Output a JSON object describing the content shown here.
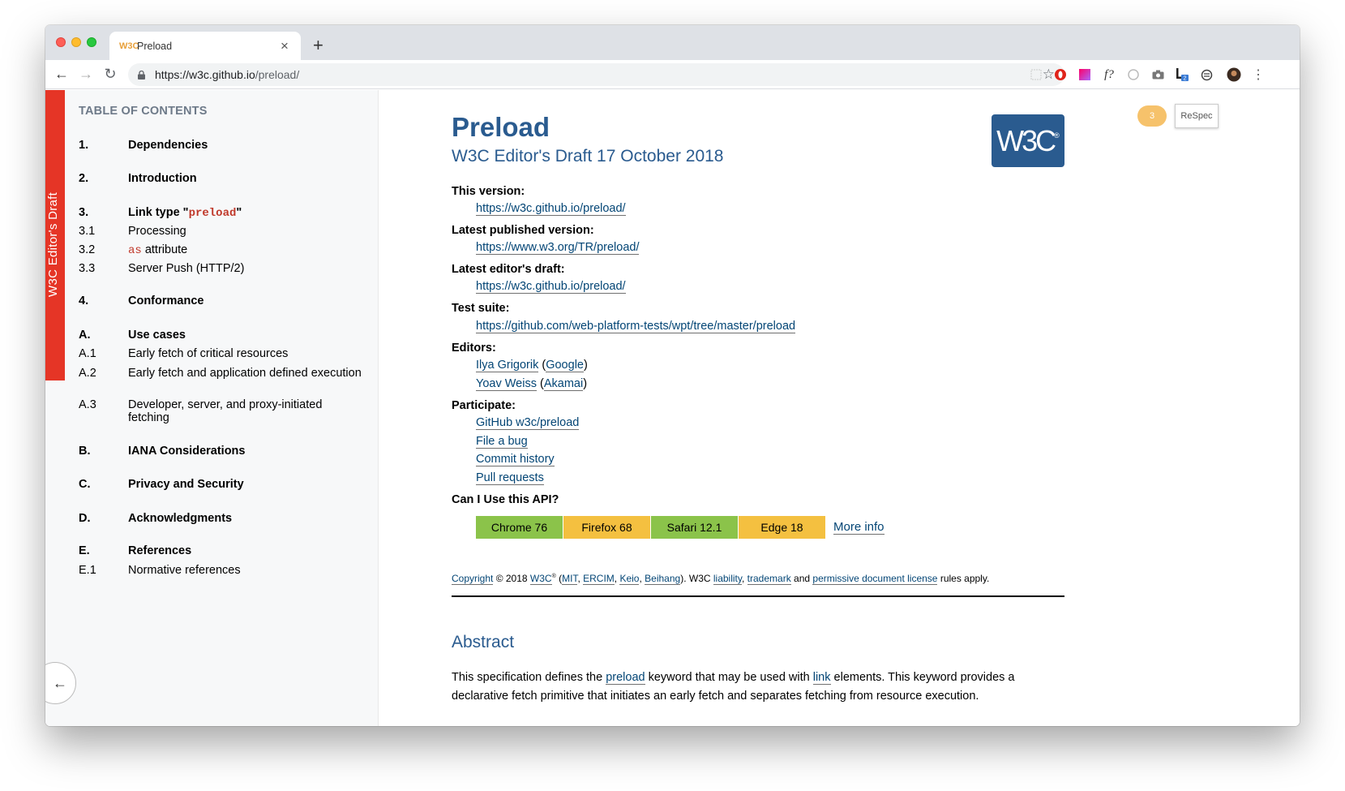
{
  "browser": {
    "tab_favicon": "W3C",
    "tab_title": "Preload",
    "tab_close": "×",
    "new_tab": "+",
    "url_host": "https://w3c.github.io",
    "url_path": "/preload/",
    "extension_f": "f?"
  },
  "sidebar": {
    "strip_text": "W3C Editor's Draft",
    "toc_heading": "TABLE OF CONTENTS",
    "items": [
      {
        "num": "1.",
        "label": "Dependencies"
      },
      {
        "num": "2.",
        "label": "Introduction"
      },
      {
        "num": "3.",
        "label_pre": "Link type \"",
        "label_code": "preload",
        "label_post": "\""
      },
      {
        "num": "3.1",
        "label": "Processing"
      },
      {
        "num": "3.2",
        "label_code": "as",
        "label_post": " attribute"
      },
      {
        "num": "3.3",
        "label": "Server Push (HTTP/2)"
      },
      {
        "num": "4.",
        "label": "Conformance"
      },
      {
        "num": "A.",
        "label": "Use cases"
      },
      {
        "num": "A.1",
        "label": "Early fetch of critical resources"
      },
      {
        "num": "A.2",
        "label": "Early fetch and application defined execution"
      },
      {
        "num": "A.3",
        "label": "Developer, server, and proxy-initiated fetching"
      },
      {
        "num": "B.",
        "label": "IANA Considerations"
      },
      {
        "num": "C.",
        "label": "Privacy and Security"
      },
      {
        "num": "D.",
        "label": "Acknowledgments"
      },
      {
        "num": "E.",
        "label": "References"
      },
      {
        "num": "E.1",
        "label": "Normative references"
      }
    ],
    "back_arrow": "←"
  },
  "respec": {
    "count": "3",
    "button": "ReSpec"
  },
  "doc": {
    "title": "Preload",
    "subtitle": "W3C Editor's Draft 17 October 2018",
    "logo": "W3C",
    "this_version_label": "This version:",
    "this_version_url": "https://w3c.github.io/preload/",
    "latest_published_label": "Latest published version:",
    "latest_published_url": "https://www.w3.org/TR/preload/",
    "latest_editors_label": "Latest editor's draft:",
    "latest_editors_url": "https://w3c.github.io/preload/",
    "test_suite_label": "Test suite:",
    "test_suite_url": "https://github.com/web-platform-tests/wpt/tree/master/preload",
    "editors_label": "Editors:",
    "editors": [
      {
        "name": "Ilya Grigorik",
        "org": "Google"
      },
      {
        "name": "Yoav Weiss",
        "org": "Akamai"
      }
    ],
    "participate_label": "Participate:",
    "participate": [
      "GitHub w3c/preload",
      "File a bug",
      "Commit history",
      "Pull requests"
    ],
    "caniuse_label": "Can I Use this API?",
    "caniuse": [
      {
        "label": "Chrome 76",
        "color": "#8bc34a"
      },
      {
        "label": "Firefox 68",
        "color": "#f4c040"
      },
      {
        "label": "Safari 12.1",
        "color": "#8bc34a"
      },
      {
        "label": "Edge 18",
        "color": "#f4c040"
      }
    ],
    "caniuse_more": "More info",
    "copyright": {
      "copyright_link": "Copyright",
      "year": " © 2018 ",
      "w3c": "W3C",
      "reg": "®",
      "mit": "MIT",
      "ercim": "ERCIM",
      "keio": "Keio",
      "beihang": "Beihang",
      "liability": "liability",
      "trademark": "trademark",
      "license": "permissive document license",
      "tail": " rules apply."
    },
    "abstract_heading": "Abstract",
    "abstract_pre": "This specification defines the ",
    "abstract_link1": "preload",
    "abstract_mid": " keyword that may be used with ",
    "abstract_link2": "link",
    "abstract_post": " elements. This keyword provides a declarative fetch primitive that initiates an early fetch and separates fetching from resource execution."
  }
}
